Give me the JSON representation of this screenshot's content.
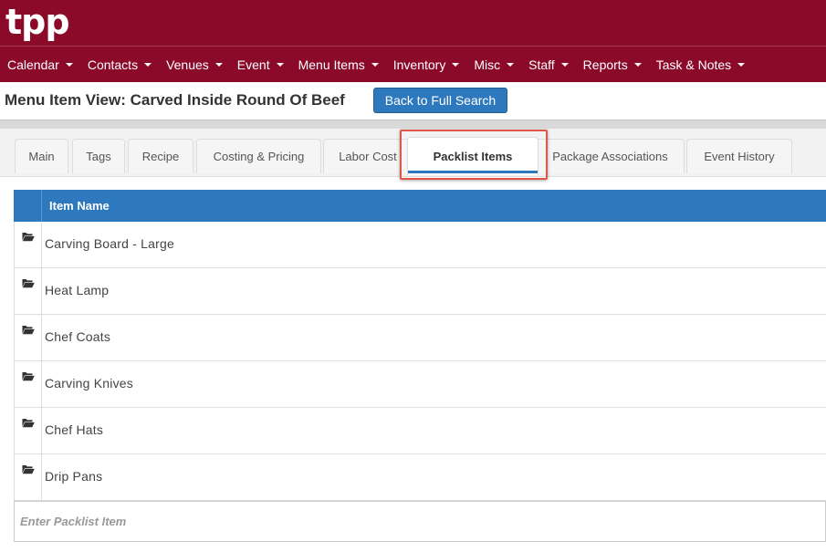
{
  "brand": {
    "logo_text": "tpp",
    "color": "#8b0a2a"
  },
  "nav": [
    {
      "label": "Calendar"
    },
    {
      "label": "Contacts"
    },
    {
      "label": "Venues"
    },
    {
      "label": "Event"
    },
    {
      "label": "Menu Items"
    },
    {
      "label": "Inventory"
    },
    {
      "label": "Misc"
    },
    {
      "label": "Staff"
    },
    {
      "label": "Reports"
    },
    {
      "label": "Task & Notes"
    }
  ],
  "page": {
    "title": "Menu Item View: Carved Inside Round Of Beef",
    "back_button": "Back to Full Search"
  },
  "tabs": [
    {
      "label": "Main",
      "active": false
    },
    {
      "label": "Tags",
      "active": false
    },
    {
      "label": "Recipe",
      "active": false
    },
    {
      "label": "Costing & Pricing",
      "active": false
    },
    {
      "label": "Labor Cost",
      "active": false
    },
    {
      "label": "Packlist Items",
      "active": true
    },
    {
      "label": "Package Associations",
      "active": false
    },
    {
      "label": "Event History",
      "active": false
    }
  ],
  "table": {
    "column_header": "Item Name",
    "row_icon": "folder-open-icon",
    "rows": [
      {
        "name": "Carving Board - Large"
      },
      {
        "name": "Heat Lamp"
      },
      {
        "name": "Chef Coats"
      },
      {
        "name": "Carving Knives"
      },
      {
        "name": "Chef Hats"
      },
      {
        "name": "Drip Pans"
      }
    ]
  },
  "entry": {
    "placeholder": "Enter Packlist Item",
    "value": ""
  },
  "colors": {
    "accent": "#2e79bd",
    "highlight": "#e0574a"
  }
}
